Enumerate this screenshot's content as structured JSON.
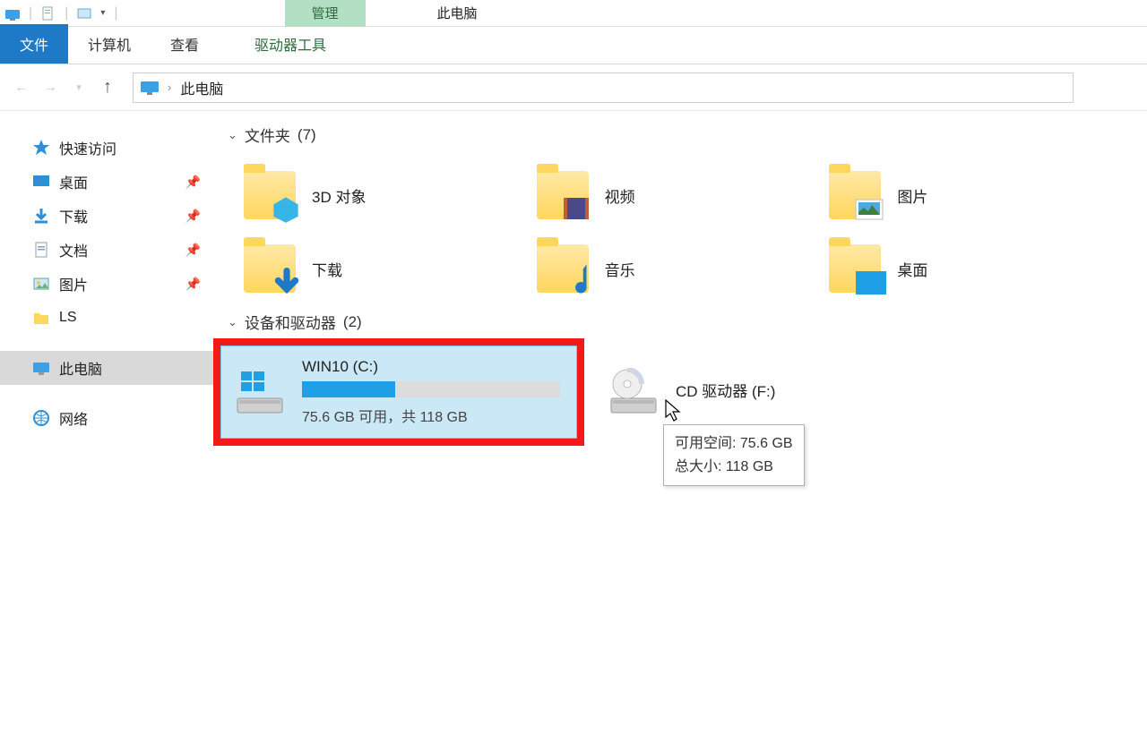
{
  "titlebar": {
    "ribbon_context_tab": "管理",
    "window_title": "此电脑"
  },
  "ribbon_tabs": {
    "file": "文件",
    "computer": "计算机",
    "view": "查看",
    "drive_tools": "驱动器工具"
  },
  "breadcrumb": {
    "root": "此电脑"
  },
  "tree": {
    "quick_access": "快速访问",
    "desktop": "桌面",
    "downloads": "下载",
    "documents": "文档",
    "pictures": "图片",
    "ls": "LS",
    "this_pc": "此电脑",
    "network": "网络"
  },
  "groups": {
    "folders": {
      "label": "文件夹",
      "count": "(7)"
    },
    "devices": {
      "label": "设备和驱动器",
      "count": "(2)"
    }
  },
  "folders": {
    "objects3d": "3D 对象",
    "videos": "视频",
    "pictures": "图片",
    "downloads": "下载",
    "music": "音乐",
    "desktop": "桌面"
  },
  "drives": {
    "c": {
      "name": "WIN10 (C:)",
      "status": "75.6 GB 可用，共 118 GB",
      "fill_percent": 36
    },
    "f": {
      "name": "CD 驱动器 (F:)"
    }
  },
  "tooltip": {
    "line1": "可用空间: 75.6 GB",
    "line2": "总大小: 118 GB"
  }
}
